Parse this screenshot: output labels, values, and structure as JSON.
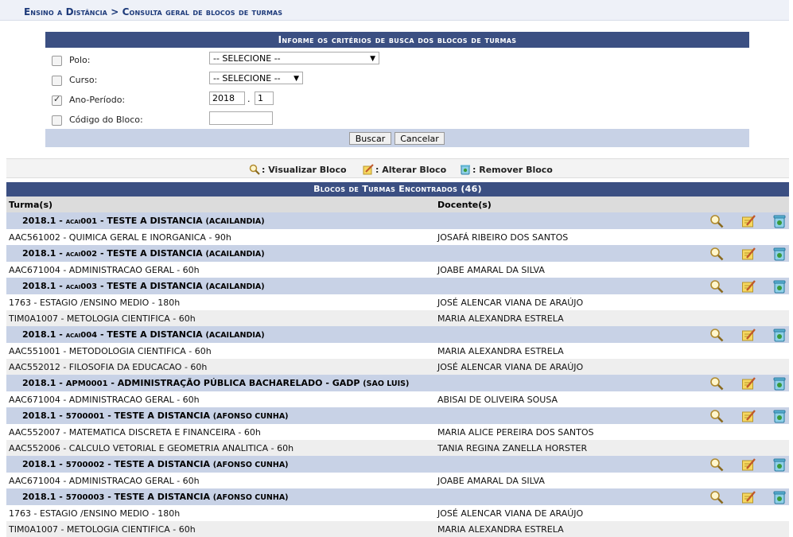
{
  "breadcrumb": "Ensino a Distância > Consulta geral de blocos de turmas",
  "form": {
    "caption": "Informe os critérios de busca dos blocos de turmas",
    "fields": [
      {
        "label": "Polo:",
        "checked": false,
        "value": "-- SELECIONE --"
      },
      {
        "label": "Curso:",
        "checked": false,
        "value": "-- SELECIONE --"
      },
      {
        "label": "Ano-Período:",
        "checked": true,
        "ano": "2018",
        "periodo": "1",
        "separator": "."
      },
      {
        "label": "Código do Bloco:",
        "checked": false,
        "value": ""
      }
    ],
    "buscar": "Buscar",
    "cancelar": "Cancelar"
  },
  "legend": {
    "visualizar": ": Visualizar Bloco",
    "alterar": ": Alterar Bloco",
    "remover": ": Remover Bloco"
  },
  "results": {
    "caption": "Blocos de Turmas Encontrados (46)",
    "col_turma": "Turma(s)",
    "col_docente": "Docente(s)",
    "groups": [
      {
        "prefix": "2018.1 - ",
        "code": "acai001",
        "title": " - TESTE A DISTANCIA ",
        "polo": "(ACAILANDIA)",
        "rows": [
          [
            "AAC561002 - QUIMICA GERAL E INORGANICA - 90h",
            "JOSAFÁ RIBEIRO DOS SANTOS"
          ]
        ]
      },
      {
        "prefix": "2018.1 - ",
        "code": "acai002",
        "title": " - TESTE A DISTANCIA ",
        "polo": "(ACAILANDIA)",
        "rows": [
          [
            "AAC671004 - ADMINISTRACAO GERAL - 60h",
            "JOABE AMARAL DA SILVA"
          ]
        ]
      },
      {
        "prefix": "2018.1 - ",
        "code": "acai003",
        "title": " - TESTE A DISTANCIA ",
        "polo": "(ACAILANDIA)",
        "rows": [
          [
            "1763 - ESTAGIO /ENSINO MEDIO - 180h",
            "JOSÉ ALENCAR VIANA DE ARAÚJO"
          ],
          [
            "TIM0A1007 - METOLOGIA CIENTIFICA - 60h",
            "MARIA ALEXANDRA ESTRELA"
          ]
        ]
      },
      {
        "prefix": "2018.1 - ",
        "code": "acai004",
        "title": " - TESTE A DISTANCIA ",
        "polo": "(ACAILANDIA)",
        "rows": [
          [
            "AAC551001 - METODOLOGIA CIENTIFICA - 60h",
            "MARIA ALEXANDRA ESTRELA"
          ],
          [
            "AAC552012 - FILOSOFIA DA EDUCACAO - 60h",
            "JOSÉ ALENCAR VIANA DE ARAÚJO"
          ]
        ]
      },
      {
        "prefix": "2018.1 - ",
        "code": "APM0001",
        "title": " - ADMINISTRAÇÃO PÚBLICA BACHARELADO - GADP ",
        "polo": "(SAO LUIS)",
        "rows": [
          [
            "AAC671004 - ADMINISTRACAO GERAL - 60h",
            "ABISAI DE OLIVEIRA SOUSA"
          ]
        ]
      },
      {
        "prefix": "2018.1 - ",
        "code": "5700001",
        "title": " - TESTE A DISTANCIA ",
        "polo": "(AFONSO CUNHA)",
        "rows": [
          [
            "AAC552007 - MATEMATICA DISCRETA E FINANCEIRA - 60h",
            "MARIA ALICE PEREIRA DOS SANTOS"
          ],
          [
            "AAC552006 - CALCULO VETORIAL E GEOMETRIA ANALITICA - 60h",
            "TANIA REGINA ZANELLA HORSTER"
          ]
        ]
      },
      {
        "prefix": "2018.1 - ",
        "code": "5700002",
        "title": " - TESTE A DISTANCIA ",
        "polo": "(AFONSO CUNHA)",
        "rows": [
          [
            "AAC671004 - ADMINISTRACAO GERAL - 60h",
            "JOABE AMARAL DA SILVA"
          ]
        ]
      },
      {
        "prefix": "2018.1 - ",
        "code": "5700003",
        "title": " - TESTE A DISTANCIA ",
        "polo": "(AFONSO CUNHA)",
        "rows": [
          [
            "1763 - ESTAGIO /ENSINO MEDIO - 180h",
            "JOSÉ ALENCAR VIANA DE ARAÚJO"
          ],
          [
            "TIM0A1007 - METOLOGIA CIENTIFICA - 60h",
            "MARIA ALEXANDRA ESTRELA"
          ]
        ]
      }
    ]
  }
}
